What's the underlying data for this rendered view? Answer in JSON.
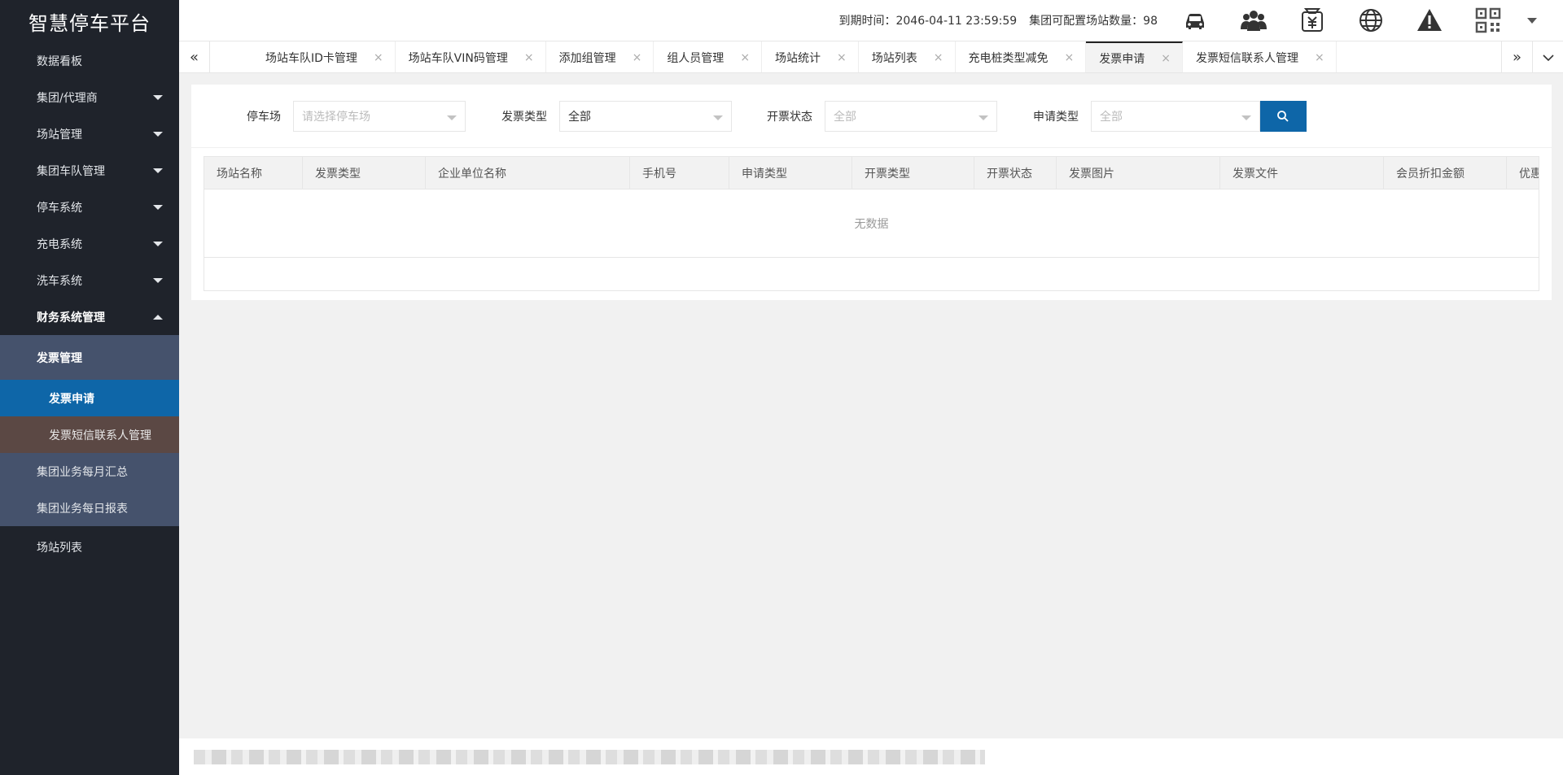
{
  "app": {
    "title": "智慧停车平台"
  },
  "sidebar": {
    "top_items": [
      {
        "label": "数据看板",
        "arrow": "none"
      },
      {
        "label": "集团/代理商",
        "arrow": "down"
      },
      {
        "label": "场站管理",
        "arrow": "down"
      },
      {
        "label": "集团车队管理",
        "arrow": "down"
      },
      {
        "label": "停车系统",
        "arrow": "down"
      },
      {
        "label": "充电系统",
        "arrow": "down"
      },
      {
        "label": "洗车系统",
        "arrow": "down"
      }
    ],
    "finance": {
      "label": "财务系统管理"
    },
    "invoice_group": {
      "label": "发票管理",
      "items": [
        {
          "label": "发票申请",
          "state": "active"
        },
        {
          "label": "发票短信联系人管理",
          "state": "hover"
        }
      ]
    },
    "finance_items": [
      {
        "label": "集团业务每月汇总"
      },
      {
        "label": "集团业务每日报表"
      }
    ],
    "bottom_item": {
      "label": "场站列表"
    }
  },
  "header": {
    "expire_label": "到期时间：2046-04-11 23:59:59",
    "station_count_label": "集团可配置场站数量：98",
    "icons": [
      "car-icon",
      "group-icon",
      "invoice-yuan-icon",
      "globe-icon",
      "warning-icon",
      "qrcode-icon"
    ]
  },
  "tabs": {
    "items": [
      {
        "label": "场站车队ID卡管理",
        "active": false
      },
      {
        "label": "场站车队VIN码管理",
        "active": false
      },
      {
        "label": "添加组管理",
        "active": false
      },
      {
        "label": "组人员管理",
        "active": false
      },
      {
        "label": "场站统计",
        "active": false
      },
      {
        "label": "场站列表",
        "active": false
      },
      {
        "label": "充电桩类型减免",
        "active": false
      },
      {
        "label": "发票申请",
        "active": true
      },
      {
        "label": "发票短信联系人管理",
        "active": false
      }
    ],
    "close_glyph": "×"
  },
  "filters": {
    "parking": {
      "label": "停车场",
      "placeholder": "请选择停车场"
    },
    "invoice_type": {
      "label": "发票类型",
      "value": "全部"
    },
    "issue_status": {
      "label": "开票状态",
      "placeholder": "全部"
    },
    "apply_type": {
      "label": "申请类型",
      "placeholder": "全部"
    }
  },
  "table": {
    "columns": [
      "场站名称",
      "发票类型",
      "企业单位名称",
      "手机号",
      "申请类型",
      "开票类型",
      "开票状态",
      "发票图片",
      "发票文件",
      "会员折扣金额",
      "优惠"
    ],
    "empty_text": "无数据"
  },
  "colors": {
    "sidebar_bg": "#1f232b",
    "submenu_bg": "#45526c",
    "active_blue": "#0e66a8",
    "hover_brown": "#5b4844"
  }
}
